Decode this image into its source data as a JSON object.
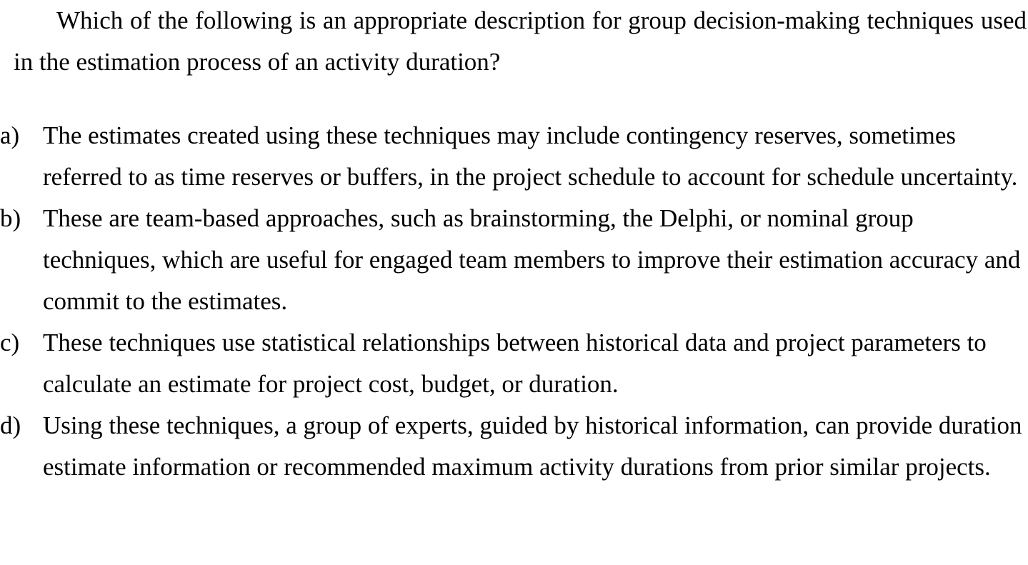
{
  "question": {
    "text": "Which of the following is an appropriate description for group decision-making techniques used in the estimation process of an activity duration?"
  },
  "options": [
    {
      "letter": "a)",
      "text": "The estimates created using these techniques may include contingency reserves, sometimes referred to as time reserves or buffers, in the project schedule to account for schedule uncertainty."
    },
    {
      "letter": "b)",
      "text": "These are team-based approaches, such as brainstorming, the Delphi, or nominal group techniques, which are useful for engaged team members to improve their estimation accuracy and commit to the estimates."
    },
    {
      "letter": "c)",
      "text": "These techniques use statistical relationships between historical data and project parameters to calculate an estimate for project cost, budget, or duration."
    },
    {
      "letter": "d)",
      "text": "Using these techniques, a group of experts, guided by historical information, can provide duration estimate information or recommended maximum activity durations from prior similar projects."
    }
  ]
}
